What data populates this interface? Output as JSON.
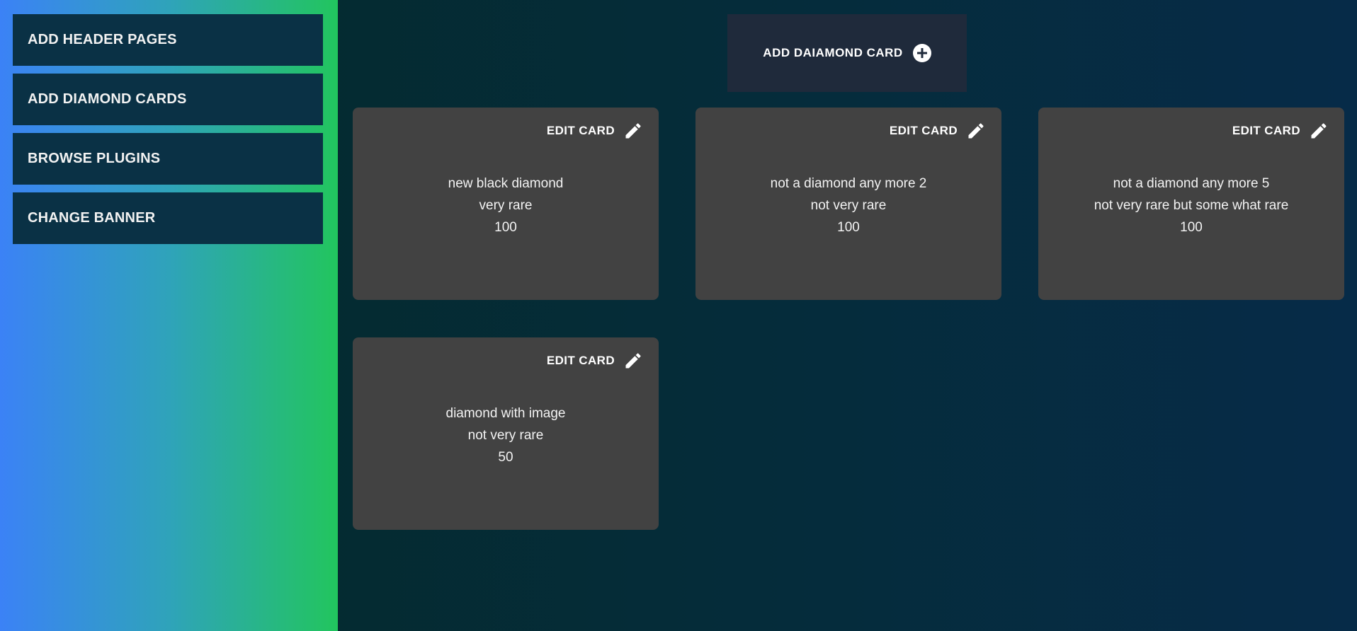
{
  "sidebar": {
    "items": [
      {
        "label": "ADD HEADER PAGES"
      },
      {
        "label": "ADD DIAMOND CARDS"
      },
      {
        "label": "BROWSE PLUGINS"
      },
      {
        "label": "CHANGE BANNER"
      }
    ]
  },
  "main": {
    "add_button_label": "ADD DAIAMOND CARD",
    "cards": [
      {
        "edit_label": "EDIT CARD",
        "name": "new black diamond",
        "rarity": "very rare",
        "value": "100"
      },
      {
        "edit_label": "EDIT CARD",
        "name": "not a diamond any more 2",
        "rarity": "not very rare",
        "value": "100"
      },
      {
        "edit_label": "EDIT CARD",
        "name": "not a diamond any more 5",
        "rarity": "not very rare but some what rare",
        "value": "100"
      },
      {
        "edit_label": "EDIT CARD",
        "name": "diamond with image",
        "rarity": "not very rare",
        "value": "50"
      }
    ]
  },
  "icons": {
    "add": "plus-circle-icon",
    "edit": "pencil-icon"
  },
  "colors": {
    "sidebar_gradient_start": "#3b82f6",
    "sidebar_gradient_end": "#22c55e",
    "sidebar_button_bg": "#0a3145",
    "card_bg": "#424242",
    "add_button_bg": "#1f2a3b"
  }
}
